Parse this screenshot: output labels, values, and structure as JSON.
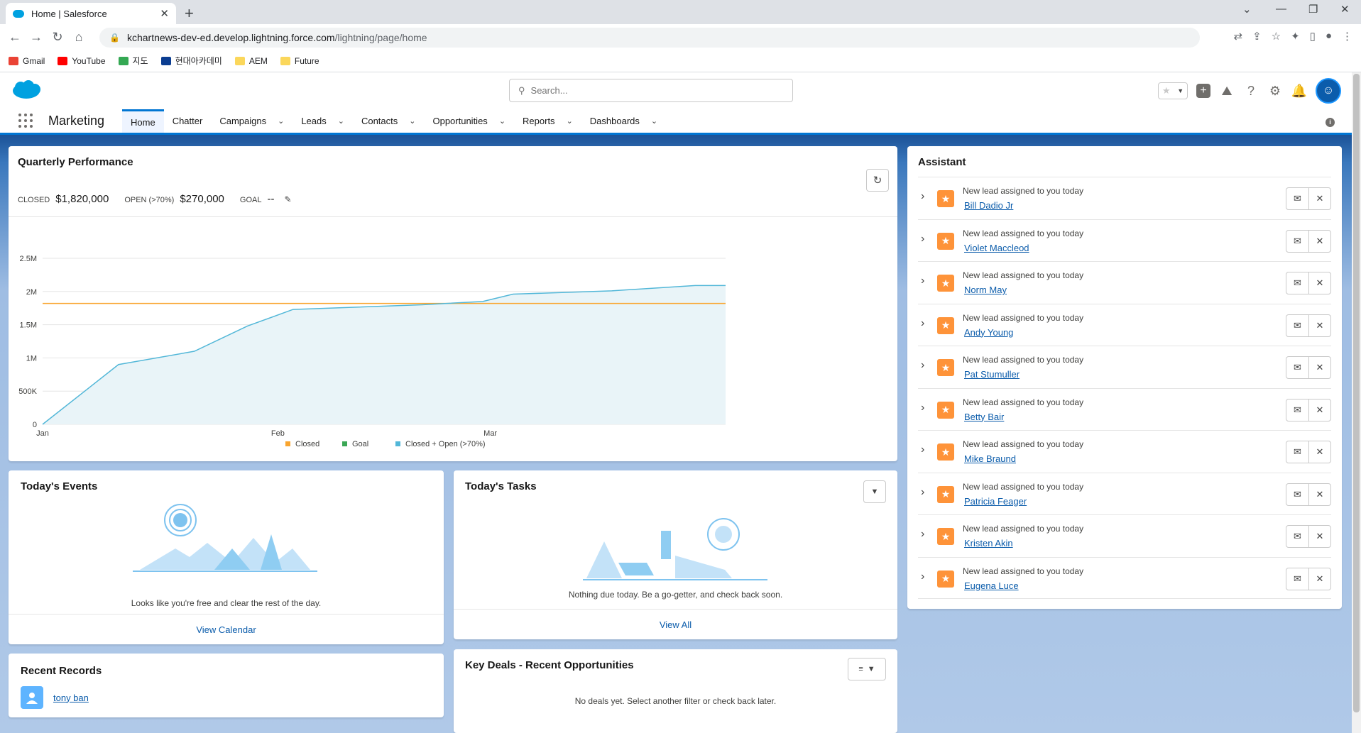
{
  "browser": {
    "tab_title": "Home | Salesforce",
    "url_host": "kchartnews-dev-ed.develop.lightning.force.com",
    "url_path": "/lightning/page/home",
    "bookmarks": [
      {
        "label": "Gmail",
        "color": "#ea4335"
      },
      {
        "label": "YouTube",
        "color": "#ff0000"
      },
      {
        "label": "지도",
        "color": "#34a853"
      },
      {
        "label": "현대아카데미",
        "color": "#0b3d91"
      },
      {
        "label": "AEM",
        "color": "#fbd75b"
      },
      {
        "label": "Future",
        "color": "#fbd75b"
      }
    ]
  },
  "header": {
    "search_placeholder": "Search...",
    "app_name": "Marketing"
  },
  "nav": [
    {
      "label": "Home",
      "active": true,
      "dropdown": false
    },
    {
      "label": "Chatter",
      "active": false,
      "dropdown": false
    },
    {
      "label": "Campaigns",
      "active": false,
      "dropdown": true
    },
    {
      "label": "Leads",
      "active": false,
      "dropdown": true
    },
    {
      "label": "Contacts",
      "active": false,
      "dropdown": true
    },
    {
      "label": "Opportunities",
      "active": false,
      "dropdown": true
    },
    {
      "label": "Reports",
      "active": false,
      "dropdown": true
    },
    {
      "label": "Dashboards",
      "active": false,
      "dropdown": true
    }
  ],
  "quarterly": {
    "title": "Quarterly Performance",
    "closed_label": "CLOSED",
    "closed_value": "$1,820,000",
    "open_label": "OPEN (>70%)",
    "open_value": "$270,000",
    "goal_label": "GOAL",
    "goal_value": "--"
  },
  "chart_data": {
    "type": "line",
    "y_ticks": [
      "0",
      "500K",
      "1M",
      "1.5M",
      "2M",
      "2.5M"
    ],
    "x_ticks": [
      "Jan",
      "Feb",
      "Mar"
    ],
    "ylim": [
      0,
      2500000
    ],
    "goal": 1820000,
    "legend": [
      {
        "name": "Closed",
        "color": "#f9a52f"
      },
      {
        "name": "Goal",
        "color": "#3ba755"
      },
      {
        "name": "Closed + Open (>70%)",
        "color": "#52b7d8"
      }
    ],
    "series": [
      {
        "name": "Closed + Open (>70%)",
        "x_days": [
          0,
          10,
          20,
          27,
          33,
          50,
          58,
          62,
          75,
          86,
          90
        ],
        "values": [
          0,
          900000,
          1100000,
          1480000,
          1730000,
          1800000,
          1850000,
          1960000,
          2010000,
          2090000,
          2090000
        ]
      }
    ]
  },
  "events": {
    "title": "Today's Events",
    "empty": "Looks like you're free and clear the rest of the day.",
    "footer": "View Calendar"
  },
  "tasks": {
    "title": "Today's Tasks",
    "empty": "Nothing due today. Be a go-getter, and check back soon.",
    "footer": "View All"
  },
  "recent": {
    "title": "Recent Records",
    "items": [
      {
        "name": "tony ban"
      }
    ]
  },
  "deals": {
    "title": "Key Deals - Recent Opportunities",
    "empty": "No deals yet. Select another filter or check back later."
  },
  "assistant": {
    "title": "Assistant",
    "item_text": "New lead assigned to you today",
    "leads": [
      "Bill Dadio Jr",
      "Violet Maccleod",
      "Norm May",
      "Andy Young",
      "Pat Stumuller",
      "Betty Bair",
      "Mike Braund",
      "Patricia Feager",
      "Kristen Akin",
      "Eugena Luce"
    ]
  }
}
